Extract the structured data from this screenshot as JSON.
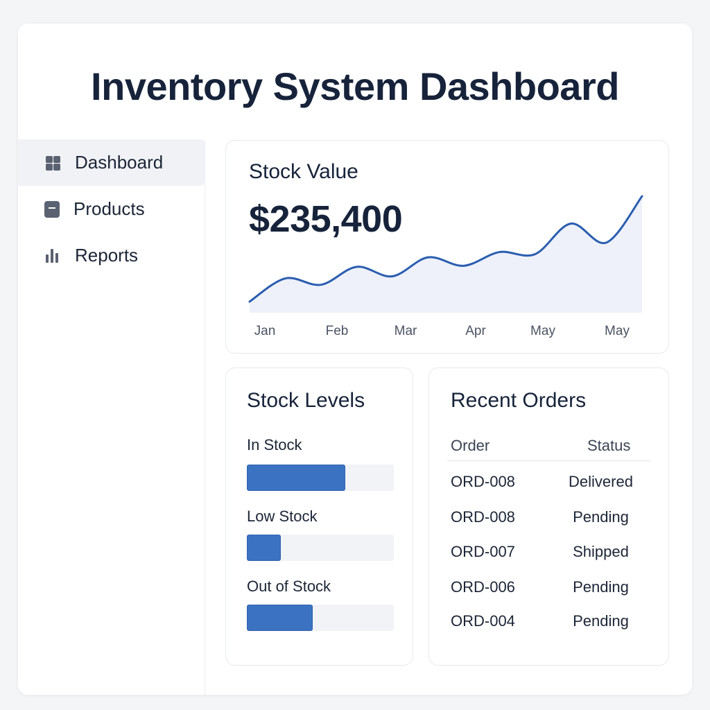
{
  "title": "Inventory System Dashboard",
  "sidebar": {
    "items": [
      {
        "label": "Dashboard",
        "icon": "grid-icon",
        "active": true
      },
      {
        "label": "Products",
        "icon": "card-icon",
        "active": false
      },
      {
        "label": "Reports",
        "icon": "bar-chart-icon",
        "active": false
      }
    ]
  },
  "stock_value": {
    "title": "Stock Value",
    "value": "$235,400"
  },
  "chart_data": {
    "type": "area",
    "categories": [
      "Jan",
      "Feb",
      "Mar",
      "Apr",
      "May",
      "May"
    ],
    "series": [
      {
        "values": [
          0,
          0.22,
          0.16,
          0.33,
          0.24,
          0.42,
          0.34,
          0.47,
          0.45,
          0.74,
          0.56,
          1.0
        ]
      }
    ],
    "line_color": "#2a5db0",
    "fill_color": "#eef1f9",
    "grid": false
  },
  "stock_levels": {
    "title": "Stock Levels",
    "items": [
      {
        "label": "In Stock",
        "fill_fraction": 0.67
      },
      {
        "label": "Low Stock",
        "fill_fraction": 0.23
      },
      {
        "label": "Out of Stock",
        "fill_fraction": 0.45
      }
    ]
  },
  "orders": {
    "title": "Recent Orders",
    "col_order": "Order",
    "col_status": "Status",
    "rows": [
      {
        "id": "ORD-008",
        "status": "Delivered"
      },
      {
        "id": "ORD-008",
        "status": "Pending"
      },
      {
        "id": "ORD-007",
        "status": "Shipped"
      },
      {
        "id": "ORD-006",
        "status": "Pending"
      },
      {
        "id": "ORD-004",
        "status": "Pending"
      }
    ]
  },
  "colors": {
    "accent": "#3b73c2",
    "text": "#16233a",
    "icon": "#5a6170"
  }
}
